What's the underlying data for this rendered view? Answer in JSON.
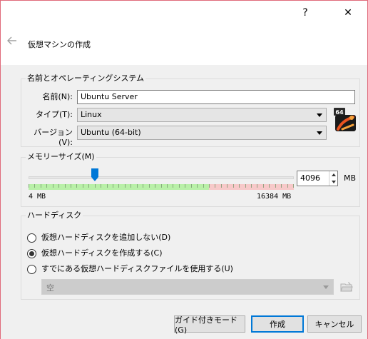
{
  "titlebar": {
    "help": "?",
    "close": "✕"
  },
  "page": {
    "title": "仮想マシンの作成"
  },
  "name_os": {
    "group_label": "名前とオペレーティングシステム",
    "name_label": "名前(N):",
    "name_value": "Ubuntu Server",
    "type_label": "タイプ(T):",
    "type_value": "Linux",
    "version_label": "バージョン(V):",
    "version_value": "Ubuntu (64-bit)",
    "os_icon": "ubuntu-64-os-icon",
    "os_icon_badge": "64"
  },
  "memory": {
    "group_label": "メモリーサイズ(M)",
    "value": "4096",
    "value_mb": 4096,
    "unit": "MB",
    "min_label": "4 MB",
    "max_label": "16384 MB",
    "min_mb": 4,
    "max_mb": 16384
  },
  "disk": {
    "group_label": "ハードディスク",
    "options": [
      {
        "label": "仮想ハードディスクを追加しない(D)",
        "checked": false
      },
      {
        "label": "仮想ハードディスクを作成する(C)",
        "checked": true
      },
      {
        "label": "すでにある仮想ハードディスクファイルを使用する(U)",
        "checked": false
      }
    ],
    "file_value": "空"
  },
  "footer": {
    "guided": "ガイド付きモード(G)",
    "create": "作成",
    "cancel": "キャンセル"
  },
  "colors": {
    "accent": "#0078d7",
    "slider_green": "#b9f0a8",
    "slider_red": "#f7c9c9",
    "window_border": "#e06a7a"
  }
}
